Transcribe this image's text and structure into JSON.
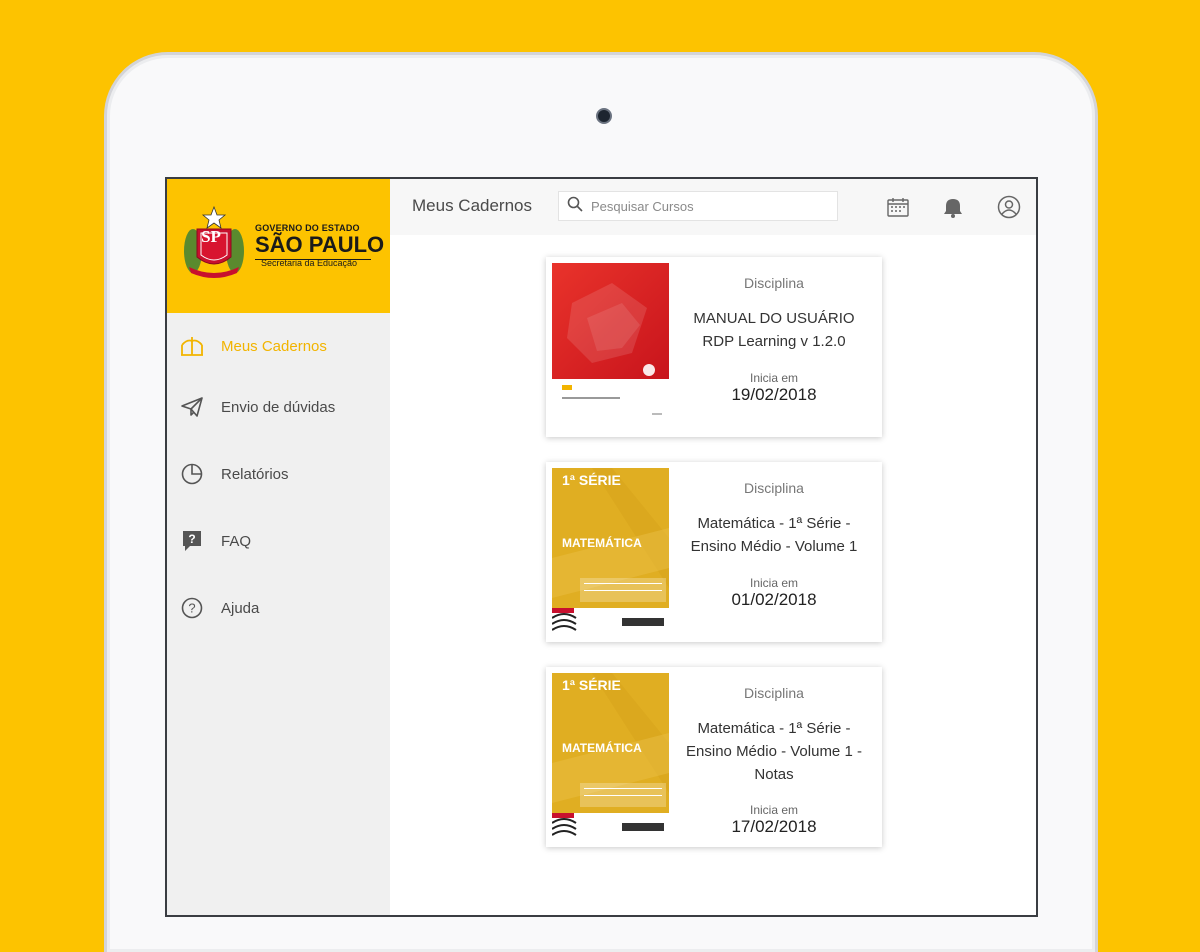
{
  "brand": {
    "line1": "GOVERNO DO ESTADO",
    "line2": "SÃO PAULO",
    "line3": "Secretaria da Educação",
    "seal_letters": "SP",
    "accent": "#FDC300"
  },
  "sidebar": {
    "items": [
      {
        "label": "Meus Cadernos",
        "icon": "books-icon",
        "active": true
      },
      {
        "label": "Envio de dúvidas",
        "icon": "paper-plane-icon",
        "active": false
      },
      {
        "label": "Relatórios",
        "icon": "pie-chart-icon",
        "active": false
      },
      {
        "label": "FAQ",
        "icon": "question-bubble-icon",
        "active": false
      },
      {
        "label": "Ajuda",
        "icon": "help-circle-icon",
        "active": false
      }
    ]
  },
  "header": {
    "title": "Meus Cadernos",
    "search_placeholder": "Pesquisar Cursos",
    "icons": [
      "calendar-icon",
      "notification-icon",
      "user-icon"
    ]
  },
  "cards": [
    {
      "subject": "Disciplina",
      "title": "MANUAL DO USUÁRIO RDP Learning v 1.2.0",
      "starts_label": "Inicia em",
      "start_date": "19/02/2018",
      "cover": "red"
    },
    {
      "subject": "Disciplina",
      "title": "Matemática - 1ª Série - Ensino Médio - Volume 1",
      "starts_label": "Inicia em",
      "start_date": "01/02/2018",
      "cover": "yellow",
      "cover_serie": "1ª SÉRIE",
      "cover_subject": "MATEMÁTICA"
    },
    {
      "subject": "Disciplina",
      "title": "Matemática - 1ª Série - Ensino Médio - Volume 1 - Notas",
      "starts_label": "Inicia em",
      "start_date": "17/02/2018",
      "cover": "yellow",
      "cover_serie": "1ª SÉRIE",
      "cover_subject": "MATEMÁTICA"
    }
  ]
}
